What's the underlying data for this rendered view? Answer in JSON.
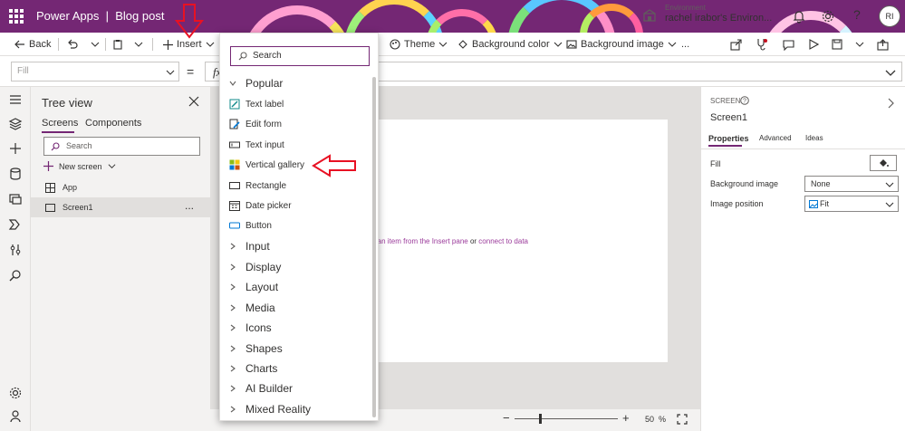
{
  "topbar": {
    "app_name": "Power Apps",
    "separator": "|",
    "doc_name": "Blog post",
    "env_label": "Environment",
    "env_name": "rachel irabor's Environ...",
    "avatar_initials": "RI",
    "help_glyph": "?"
  },
  "commandbar": {
    "back": "Back",
    "insert": "Insert",
    "theme": "Theme",
    "background_color": "Background color",
    "background_image": "Background image",
    "more": "..."
  },
  "formulabar": {
    "property": "Fill",
    "equals": "=",
    "fx": "fx"
  },
  "tree": {
    "title": "Tree view",
    "tab_screens": "Screens",
    "tab_components": "Components",
    "search_placeholder": "Search",
    "new_screen": "New screen",
    "items": [
      {
        "label": "App"
      },
      {
        "label": "Screen1"
      }
    ],
    "item_menu": "..."
  },
  "canvas": {
    "hint_prefix": "d an item from the Insert pane",
    "hint_or": " or ",
    "hint_link": "connect to data",
    "zoom_value": "50",
    "zoom_unit": "%"
  },
  "properties": {
    "type_label": "SCREEN",
    "screen_name": "Screen1",
    "tab_properties": "Properties",
    "tab_advanced": "Advanced",
    "tab_ideas": "Ideas",
    "fill_label": "Fill",
    "bg_image_label": "Background image",
    "bg_image_value": "None",
    "image_position_label": "Image position",
    "image_position_value": "Fit"
  },
  "insert_pane": {
    "search_placeholder": "Search",
    "categories": [
      "Popular",
      "Input",
      "Display",
      "Layout",
      "Media",
      "Icons",
      "Shapes",
      "Charts",
      "AI Builder",
      "Mixed Reality"
    ],
    "popular_items": [
      "Text label",
      "Edit form",
      "Text input",
      "Vertical gallery",
      "Rectangle",
      "Date picker",
      "Button"
    ]
  },
  "colors": {
    "brand": "#742774",
    "annotation_arrow": "#e81123"
  }
}
